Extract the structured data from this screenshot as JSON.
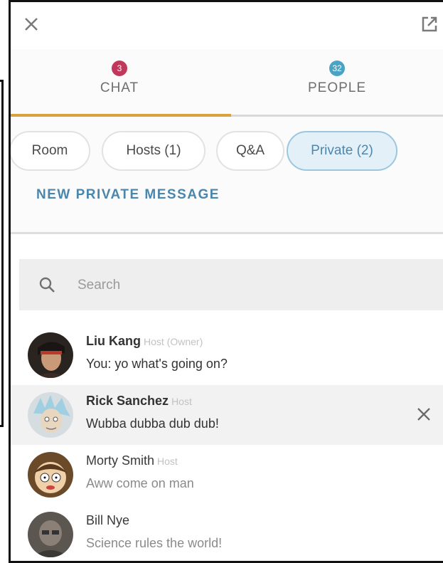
{
  "tabs": {
    "chat": {
      "label": "CHAT",
      "badge": "3",
      "badge_color": "#c0395c"
    },
    "people": {
      "label": "PEOPLE",
      "badge": "32",
      "badge_color": "#4aa3c3"
    }
  },
  "filters": {
    "chips": [
      "Room",
      "Hosts (1)",
      "Q&A",
      "Private (2)"
    ],
    "active": "Private (2)",
    "new_message_label": "NEW PRIVATE MESSAGE"
  },
  "search": {
    "placeholder": "Search",
    "value": ""
  },
  "conversations": [
    {
      "name": "Liu Kang",
      "role": "Host (Owner)",
      "preview": "You: yo what's going on?",
      "bold": true
    },
    {
      "name": "Rick Sanchez",
      "role": "Host",
      "preview": "Wubba dubba dub dub!",
      "bold": true,
      "highlighted": true
    },
    {
      "name": "Morty Smith",
      "role": "Host",
      "preview": "Aww come on man",
      "bold": false
    },
    {
      "name": "Bill Nye",
      "role": "",
      "preview": "Science rules the world!",
      "bold": false
    }
  ],
  "colors": {
    "accent": "#d8a23c",
    "link": "#4b86ad",
    "active_chip_bg": "#e3f0f8"
  }
}
